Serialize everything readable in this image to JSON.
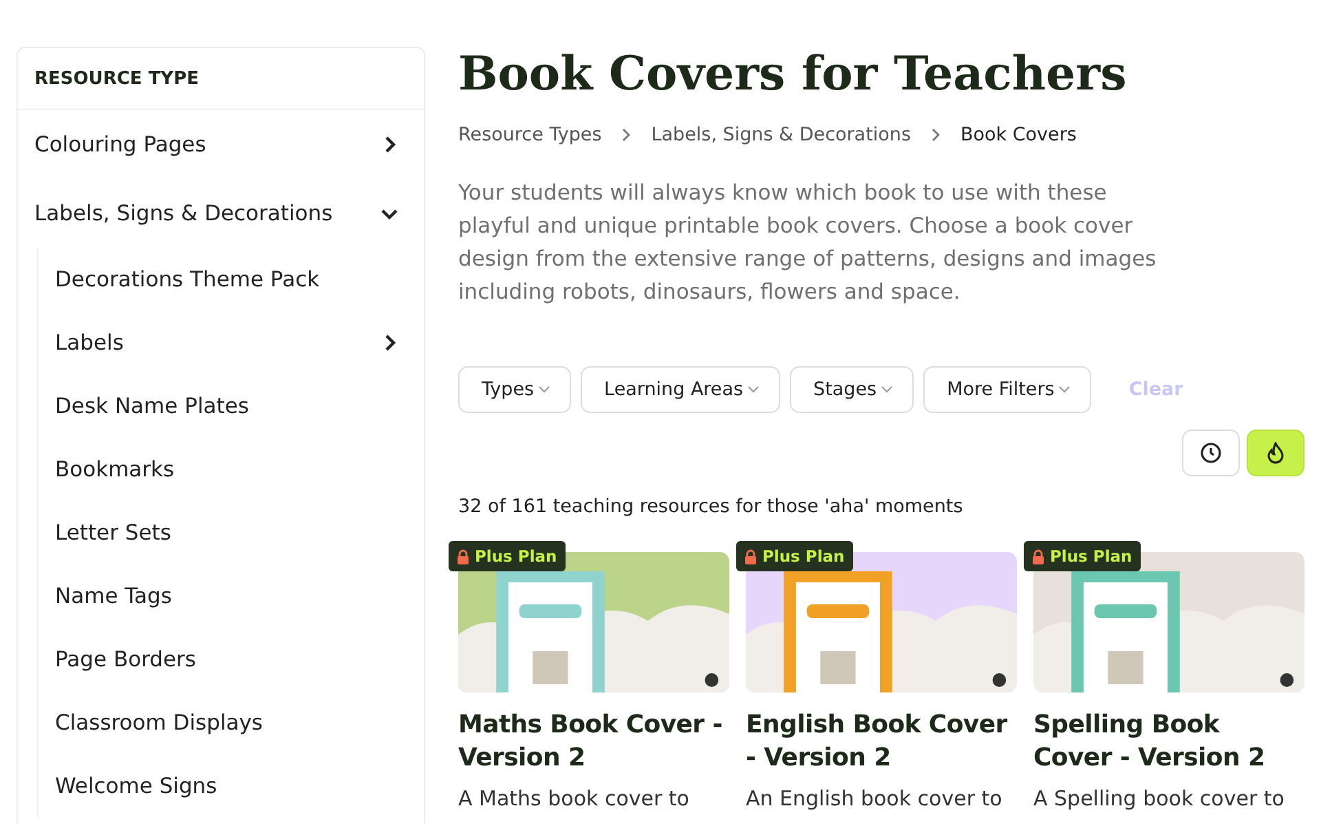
{
  "sidebar": {
    "heading": "RESOURCE TYPE",
    "items": [
      {
        "label": "Colouring Pages",
        "expanded": false
      },
      {
        "label": "Labels, Signs & Decorations",
        "expanded": true,
        "children": [
          {
            "label": "Decorations Theme Pack"
          },
          {
            "label": "Labels",
            "expanded": false
          },
          {
            "label": "Desk Name Plates"
          },
          {
            "label": "Bookmarks"
          },
          {
            "label": "Letter Sets"
          },
          {
            "label": "Name Tags"
          },
          {
            "label": "Page Borders"
          },
          {
            "label": "Classroom Displays"
          },
          {
            "label": "Welcome Signs"
          }
        ]
      }
    ]
  },
  "title": "Book Covers for Teachers",
  "breadcrumbs": [
    "Resource Types",
    "Labels, Signs & Decorations",
    "Book Covers"
  ],
  "description": "Your students will always know which book to use with these playful and unique printable book covers. Choose a book cover design from the extensive range of patterns, designs and images including robots, dinosaurs, flowers and space.",
  "filters": [
    "Types",
    "Learning Areas",
    "Stages",
    "More Filters"
  ],
  "clear": {
    "label": "Clear",
    "disabled": true
  },
  "sort_buttons": [
    {
      "kind": "recent",
      "selected": false
    },
    {
      "kind": "popular",
      "selected": true
    }
  ],
  "result_count": "32 of 161 teaching resources for those 'aha' moments",
  "cards": [
    {
      "badge": "Plus Plan",
      "title": "Maths Book Cover - Version 2",
      "description": "A Maths book cover to",
      "color": "#bcd48a"
    },
    {
      "badge": "Plus Plan",
      "title": "English Book Cover - Version 2",
      "description": "An English book cover to",
      "color": "#e6d6fb"
    },
    {
      "badge": "Plus Plan",
      "title": "Spelling Book Cover - Version 2",
      "description": "A Spelling book cover to",
      "color": "#e8e0da"
    }
  ]
}
